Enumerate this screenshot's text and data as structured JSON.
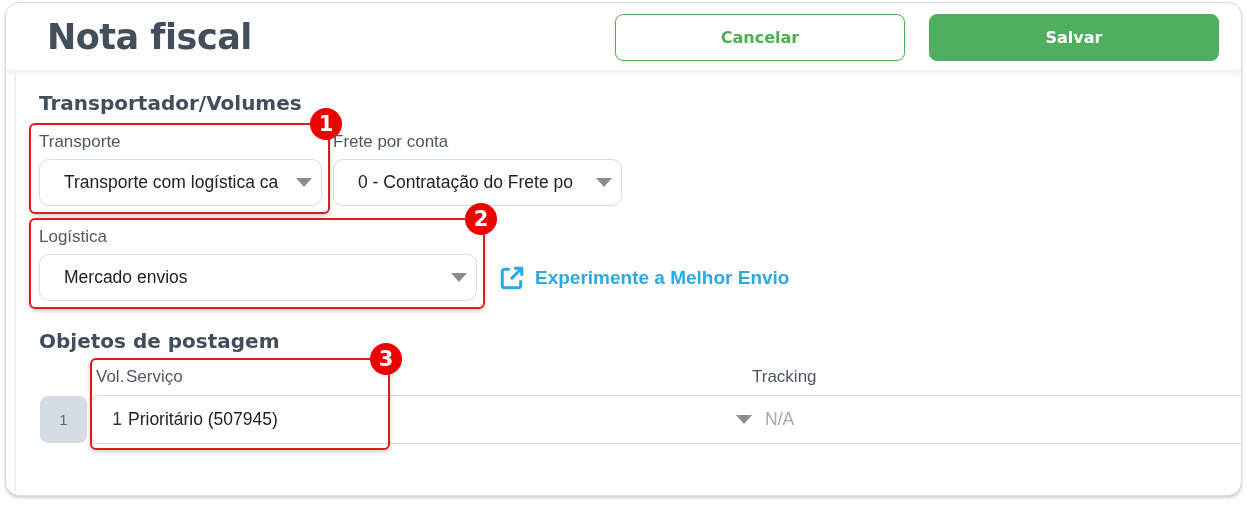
{
  "header": {
    "title": "Nota fiscal",
    "buttons": [
      {
        "label": "Cancelar",
        "kind": "outline"
      },
      {
        "label": "Salvar",
        "kind": "primary"
      }
    ]
  },
  "transport": {
    "heading": "Transportador/Volumes",
    "rows": [
      {
        "fields": [
          {
            "label": "Transporte",
            "value": "Transporte com logística ca",
            "badge": "1"
          },
          {
            "label": "Frete por conta",
            "value": "0 - Contratação do Frete po"
          }
        ]
      },
      {
        "fields": [
          {
            "label": "Logística",
            "value": "Mercado envios",
            "badge": "2"
          }
        ],
        "link": "Experimente a Melhor Envio"
      }
    ]
  },
  "postage": {
    "heading": "Objetos de postagem",
    "badge": "3",
    "columns": [
      "Vol.",
      "Serviço",
      "Tracking"
    ],
    "rows": [
      {
        "index": "1",
        "volume": "1",
        "service": "Prioritário (507945)",
        "tracking_placeholder": "N/A"
      }
    ]
  }
}
